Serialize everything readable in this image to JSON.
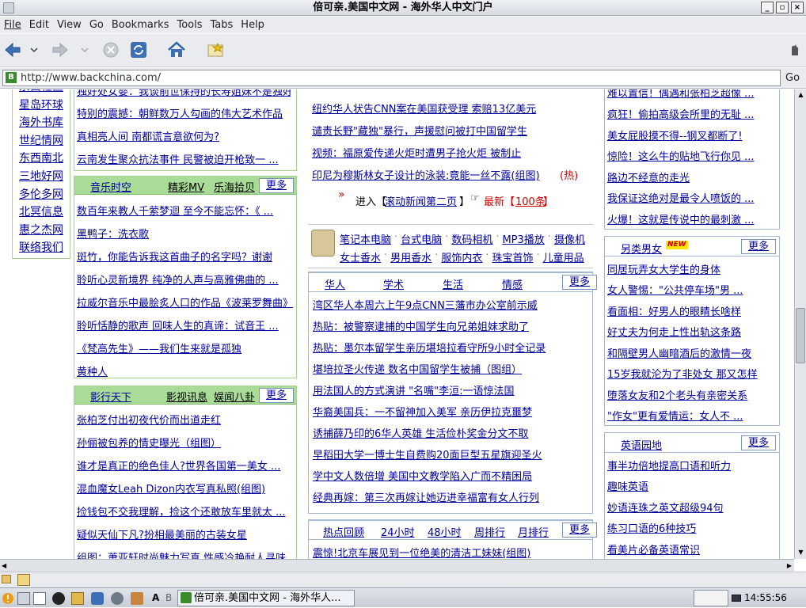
{
  "window": {
    "title": "倍可亲.美国中文网 - 海外华人中文门户",
    "controls": [
      "_",
      "▫",
      "×"
    ]
  },
  "menu": [
    "File",
    "Edit",
    "View",
    "Go",
    "Bookmarks",
    "Tools",
    "Tabs",
    "Help"
  ],
  "toolbar": {
    "icons": [
      "back-icon",
      "forward-icon",
      "stop-icon",
      "reload-icon",
      "home-icon",
      "bookmark-star-icon",
      "throbber-icon"
    ]
  },
  "urlbar": {
    "site_icon": "B",
    "url": "http://www.backchina.com/",
    "go_label": "Go"
  },
  "left_nav": [
    "泉西社区",
    "星岛环球",
    "海外书库",
    "世纪情网",
    "东西南北",
    "三地好网",
    "多伦多网",
    "北冥信息",
    "惠之杰网",
    "联络我们"
  ],
  "col2_top": {
    "items": [
      "独好处女婴：我谈前世保持的长寿姐妹不是独好...",
      "特别的震撼：朝鲜数万人勾画的伟大艺术作品",
      "真相亮人间 南都谎言意欲何为?",
      "云南发生聚众抗法事件 民警被迫开枪致一 ..."
    ]
  },
  "music": {
    "title": "音乐时空",
    "sub1": "精彩MV",
    "sub2": "乐海拾贝",
    "more": "更多",
    "items": [
      "数百年来教人千萦梦迴 至今不能忘怀：《 ...",
      "黑鸭子：洗衣歌",
      "斑竹，你能告诉我这首曲子的名字吗？谢谢",
      "聆听心灵新境界 纯净的人声与高雅佛曲的 ...",
      "拉威尔音乐中最脍炙人口的作品《波莱罗舞曲》",
      "聆听恬静的歌声 回味人生的真谛：试音王 ...",
      "《梵高先生》——我们生来就是孤独",
      "黄种人"
    ]
  },
  "film": {
    "title": "影行天下",
    "sub1": "影视讯息",
    "sub2": "娱闻八卦",
    "more": "更多",
    "items": [
      "张柏芝付出初夜代价而出道走红",
      "孙俪被包养的情史曝光（组图）",
      "谁才是真正的绝色佳人?世界各国第一美女 ...",
      "混血魔女Leah Dizon内衣写真私照(组图)",
      "捡钱包不交我理解，捡这个还敢放车里就太 ...",
      "疑似天仙下凡?扮相最美丽的古装女星",
      "组图：萧亚轩时尚魅力写真 性感冷艳耐人寻味"
    ]
  },
  "news_top": {
    "items": [
      "纽约华人状告CNN案在美国获受理 索赔13亿美元",
      "谴责长野\"藏独\"暴行，声援慰问被打中国留学生",
      "视频：福原爱传递火炬时遭男子抢火炬 被制止",
      "印尼为穆斯林女子设计的泳装:竟能一丝不露(组图)"
    ],
    "hot_tag": "(热)",
    "enter_prefix": "进入【",
    "enter_link": "滚动新闻第二页",
    "enter_suffix": "】",
    "latest_label": "最新【",
    "latest_link": "100条",
    "latest_suffix": "】"
  },
  "shop": {
    "row1": [
      "笔记本电脑",
      "台式电脑",
      "数码相机",
      "MP3播放",
      "摄像机"
    ],
    "row2": [
      "女士香水",
      "男用香水",
      "服饰内衣",
      "珠宝首饰",
      "儿童用品"
    ]
  },
  "chinese": {
    "tabs": [
      "华人",
      "学术",
      "生活",
      "情感"
    ],
    "more": "更多",
    "items": [
      "湾区华人本周六上午9点CNN三藩市办公室前示威",
      "热贴：被警察逮捕的中国学生向兄弟姐妹求助了",
      "热贴：墨尔本留学生亲历堪培拉看守所9小时全记录",
      "堪培拉圣火传递 数名中国留学生被捕（图组）",
      "用法国人的方式演讲 \"名嘴\"李洹:一语惊法国",
      "华裔美国兵：一不留神加入美军 亲历伊拉克噩梦",
      "诱捕薛乃印的6华人英雄 生活俭朴奖金分文不取",
      "早稻田大学一博士生自费购20面巨型五星旗迎圣火",
      "学中文人数倍增 美国中文教学陷入广而不精困局",
      "经典再嫁：第三次再嫁让她迈进幸福富有女人行列"
    ]
  },
  "hot": {
    "tabs": [
      "热点回顾",
      "24小时",
      "48小时",
      "周排行",
      "月排行"
    ],
    "more": "更多",
    "items": [
      "震惊!北京车展见到一位绝美的清洁工妹妹(组图)"
    ]
  },
  "right_top": {
    "items": [
      "难以置信！偶遇和张柏芝超像 ...",
      "疯狂！偷拍高级会所里的无耻 ...",
      "美女屁股摸不得--钢叉都断了!",
      "惊险！这么牛的贴地飞行你见 ...",
      "路边不经意的走光",
      "我保证这绝对是最令人喷饭的 ...",
      "火爆！这就是传说中的最刺激 ..."
    ]
  },
  "gender": {
    "title": "另类男女",
    "badge": "NEW",
    "more": "更多",
    "items": [
      "同居玩弄女大学生的身体",
      "女人警惕：\"公共停车场\"男 ...",
      "看面相：好男人的眼睛长啥样",
      "好丈夫为何走上性出轨这条路",
      "和隔壁男人幽暗酒后的激情一夜",
      "15岁我就沦为了非处女 那又怎样",
      "堕落女友和2个老头有亲密关系",
      "\"作女\"更有爱情运：女人不 ..."
    ]
  },
  "english": {
    "title": "英语园地",
    "more": "更多",
    "items": [
      "事半功倍地提高口语和听力",
      "趣味英语",
      "妙语连珠之英文超级94句",
      "练习口语的6种技巧",
      "看美片必备英语常识"
    ]
  },
  "taskbar": {
    "window_label": "倍可亲.美国中文网 - 海外华人...",
    "keyboard": [
      "A",
      "B"
    ],
    "clock": "14:55:56"
  }
}
